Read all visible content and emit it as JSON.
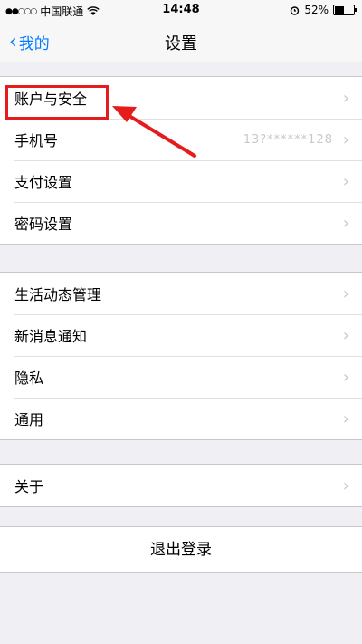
{
  "status_bar": {
    "signal": "●●○○○",
    "carrier": "中国联通",
    "time": "14:48",
    "battery_percent": "52%",
    "battery_level": 0.52
  },
  "nav": {
    "back_label": "我的",
    "title": "设置"
  },
  "group1": [
    {
      "label": "账户与安全"
    },
    {
      "label": "手机号",
      "value": "13?******128"
    },
    {
      "label": "支付设置"
    },
    {
      "label": "密码设置"
    }
  ],
  "group2": [
    {
      "label": "生活动态管理"
    },
    {
      "label": "新消息通知"
    },
    {
      "label": "隐私"
    },
    {
      "label": "通用"
    }
  ],
  "group3": [
    {
      "label": "关于"
    }
  ],
  "logout_label": "退出登录",
  "colors": {
    "accent": "#007aff",
    "annotation": "#e61b1b",
    "background": "#efeff4"
  }
}
